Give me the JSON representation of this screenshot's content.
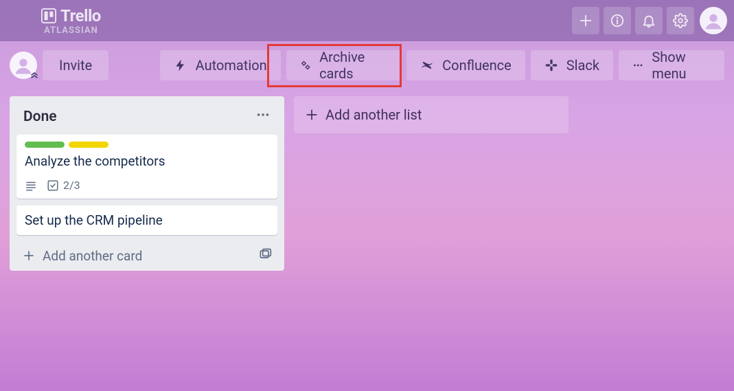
{
  "header": {
    "brand": "Trello",
    "sub_brand": "ATLASSIAN"
  },
  "board_header": {
    "invite": "Invite",
    "buttons": {
      "automation": "Automation",
      "archive": "Archive cards",
      "confluence": "Confluence",
      "slack": "Slack",
      "show_menu": "Show menu"
    }
  },
  "lists": [
    {
      "title": "Done",
      "cards": [
        {
          "title": "Analyze the competitors",
          "labels": [
            "#61bd4f",
            "#f2d600"
          ],
          "checklist": "2/3",
          "has_description": true
        },
        {
          "title": "Set up the CRM pipeline",
          "labels": [],
          "checklist": null,
          "has_description": false
        }
      ],
      "add_card": "Add another card"
    }
  ],
  "add_list": "Add another list"
}
